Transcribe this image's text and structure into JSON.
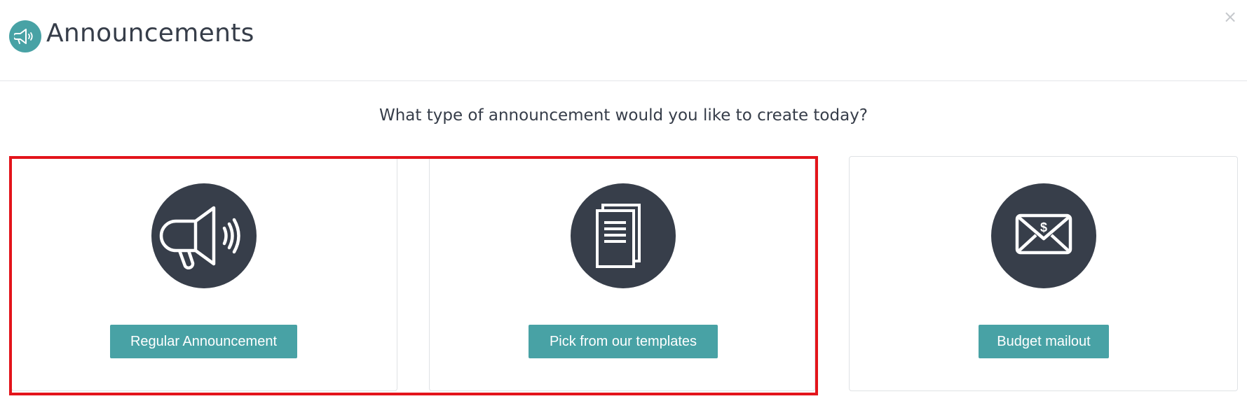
{
  "header": {
    "title": "Announcements",
    "icon": "megaphone-icon",
    "close_label": "×"
  },
  "question": "What type of announcement would you like to create today?",
  "options": [
    {
      "label": "Regular Announcement",
      "icon": "megaphone-icon"
    },
    {
      "label": "Pick from our templates",
      "icon": "documents-icon"
    },
    {
      "label": "Budget mailout",
      "icon": "envelope-dollar-icon"
    }
  ],
  "colors": {
    "accent": "#48a2a5",
    "icon_circle": "#373e4a",
    "text": "#363d49",
    "highlight": "#e3141b"
  }
}
